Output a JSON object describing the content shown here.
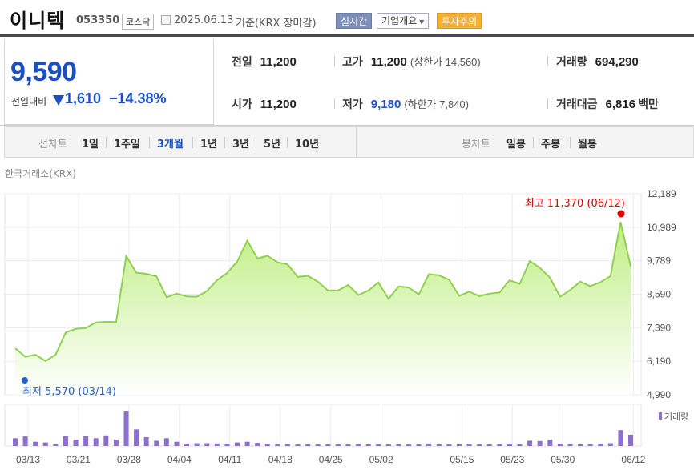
{
  "header": {
    "name": "이니텍",
    "code": "053350",
    "market": "코스닥",
    "date": "2025.06.13",
    "basis": "기준(KRX 장마감)",
    "realtime_btn": "실시간",
    "company_btn": "기업개요",
    "warning_btn": "투자주의"
  },
  "quote": {
    "price": "9,590",
    "change_label": "전일대비",
    "change": "1,610",
    "change_pct": "−14.38%",
    "prev_close_label": "전일",
    "prev_close": "11,200",
    "open_label": "시가",
    "open": "11,200",
    "high_label": "고가",
    "high": "11,200",
    "upper_limit": "(상한가 14,560)",
    "low_label": "저가",
    "low": "9,180",
    "lower_limit": "(하한가 7,840)",
    "volume_label": "거래량",
    "volume": "694,290",
    "amount_label": "거래대금",
    "amount": "6,816",
    "amount_unit": "백만"
  },
  "period_bar": {
    "line_label": "선차트",
    "line_periods": [
      "1일",
      "1주일",
      "3개월",
      "1년",
      "3년",
      "5년",
      "10년"
    ],
    "active_period": "3개월",
    "candle_label": "봉차트",
    "candle_periods": [
      "일봉",
      "주봉",
      "월봉"
    ]
  },
  "exchange_label": "한국거래소(KRX)",
  "colors": {
    "accent_blue": "#1a4fc6",
    "line_green": "#8fd14f",
    "area_top": "#cdf19f",
    "max_red": "#e00000",
    "min_blue": "#1e63c8",
    "volume_bar": "#8c6fcf"
  },
  "chart_data": {
    "type": "area",
    "x_tick_labels": [
      "03/13",
      "03/21",
      "03/28",
      "04/04",
      "04/11",
      "04/18",
      "04/25",
      "05/02",
      "05/15",
      "05/23",
      "05/30",
      "06/12"
    ],
    "y_tick_labels": [
      "12,189",
      "10,989",
      "9,789",
      "8,590",
      "7,390",
      "6,190",
      "4,990"
    ],
    "ylim": [
      4990,
      12189
    ],
    "series": [
      {
        "values": [
          6650,
          6350,
          6420,
          6200,
          6420,
          7220,
          7350,
          7380,
          7580,
          7600,
          7590,
          9960,
          9360,
          9320,
          9230,
          8480,
          8610,
          8510,
          8500,
          8700,
          9090,
          9350,
          9760,
          10510,
          9870,
          9970,
          9730,
          9660,
          9210,
          9250,
          9040,
          8720,
          8720,
          8920,
          8560,
          8720,
          9010,
          8420,
          8870,
          8830,
          8580,
          9310,
          9270,
          9110,
          8530,
          8680,
          8520,
          8610,
          8650,
          9090,
          8960,
          9780,
          9530,
          9180,
          8500,
          8740,
          9040,
          8880,
          9020,
          9240,
          11180,
          9590
        ]
      }
    ],
    "max_label": "최고 11,370 (06/12)",
    "min_label": "최저 5,570 (03/14)",
    "volume_label": "거래량",
    "volume": [
      0.22,
      0.27,
      0.12,
      0.1,
      0.05,
      0.28,
      0.18,
      0.28,
      0.22,
      0.3,
      0.18,
      1.0,
      0.47,
      0.25,
      0.15,
      0.22,
      0.12,
      0.07,
      0.08,
      0.08,
      0.07,
      0.06,
      0.1,
      0.12,
      0.09,
      0.06,
      0.05,
      0.05,
      0.04,
      0.04,
      0.04,
      0.04,
      0.04,
      0.04,
      0.05,
      0.05,
      0.04,
      0.04,
      0.05,
      0.04,
      0.04,
      0.07,
      0.05,
      0.04,
      0.05,
      0.06,
      0.04,
      0.04,
      0.04,
      0.07,
      0.04,
      0.15,
      0.14,
      0.18,
      0.06,
      0.05,
      0.05,
      0.05,
      0.06,
      0.08,
      0.45,
      0.32
    ]
  }
}
